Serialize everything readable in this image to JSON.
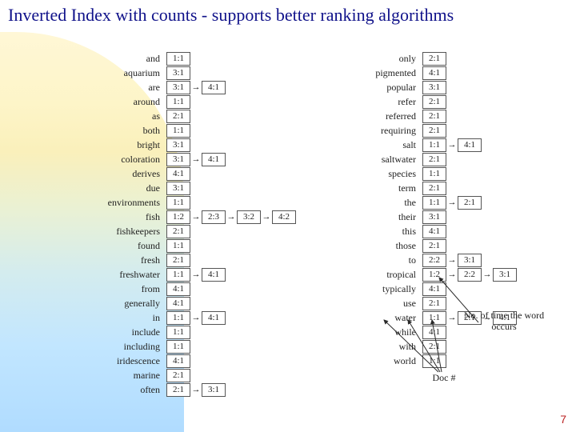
{
  "title": "Inverted Index with counts - supports better ranking algorithms",
  "page_number": "7",
  "notes": {
    "count_label": "No. of time the word occurs",
    "docnum_label": "Doc #"
  },
  "left_column": [
    {
      "term": "and",
      "postings": [
        "1:1"
      ]
    },
    {
      "term": "aquarium",
      "postings": [
        "3:1"
      ]
    },
    {
      "term": "are",
      "postings": [
        "3:1",
        "4:1"
      ]
    },
    {
      "term": "around",
      "postings": [
        "1:1"
      ]
    },
    {
      "term": "as",
      "postings": [
        "2:1"
      ]
    },
    {
      "term": "both",
      "postings": [
        "1:1"
      ]
    },
    {
      "term": "bright",
      "postings": [
        "3:1"
      ]
    },
    {
      "term": "coloration",
      "postings": [
        "3:1",
        "4:1"
      ]
    },
    {
      "term": "derives",
      "postings": [
        "4:1"
      ]
    },
    {
      "term": "due",
      "postings": [
        "3:1"
      ]
    },
    {
      "term": "environments",
      "postings": [
        "1:1"
      ]
    },
    {
      "term": "fish",
      "postings": [
        "1:2",
        "2:3",
        "3:2",
        "4:2"
      ]
    },
    {
      "term": "fishkeepers",
      "postings": [
        "2:1"
      ]
    },
    {
      "term": "found",
      "postings": [
        "1:1"
      ]
    },
    {
      "term": "fresh",
      "postings": [
        "2:1"
      ]
    },
    {
      "term": "freshwater",
      "postings": [
        "1:1",
        "4:1"
      ]
    },
    {
      "term": "from",
      "postings": [
        "4:1"
      ]
    },
    {
      "term": "generally",
      "postings": [
        "4:1"
      ]
    },
    {
      "term": "in",
      "postings": [
        "1:1",
        "4:1"
      ]
    },
    {
      "term": "include",
      "postings": [
        "1:1"
      ]
    },
    {
      "term": "including",
      "postings": [
        "1:1"
      ]
    },
    {
      "term": "iridescence",
      "postings": [
        "4:1"
      ]
    },
    {
      "term": "marine",
      "postings": [
        "2:1"
      ]
    },
    {
      "term": "often",
      "postings": [
        "2:1",
        "3:1"
      ]
    }
  ],
  "right_column": [
    {
      "term": "only",
      "postings": [
        "2:1"
      ]
    },
    {
      "term": "pigmented",
      "postings": [
        "4:1"
      ]
    },
    {
      "term": "popular",
      "postings": [
        "3:1"
      ]
    },
    {
      "term": "refer",
      "postings": [
        "2:1"
      ]
    },
    {
      "term": "referred",
      "postings": [
        "2:1"
      ]
    },
    {
      "term": "requiring",
      "postings": [
        "2:1"
      ]
    },
    {
      "term": "salt",
      "postings": [
        "1:1",
        "4:1"
      ]
    },
    {
      "term": "saltwater",
      "postings": [
        "2:1"
      ]
    },
    {
      "term": "species",
      "postings": [
        "1:1"
      ]
    },
    {
      "term": "term",
      "postings": [
        "2:1"
      ]
    },
    {
      "term": "the",
      "postings": [
        "1:1",
        "2:1"
      ]
    },
    {
      "term": "their",
      "postings": [
        "3:1"
      ]
    },
    {
      "term": "this",
      "postings": [
        "4:1"
      ]
    },
    {
      "term": "those",
      "postings": [
        "2:1"
      ]
    },
    {
      "term": "to",
      "postings": [
        "2:2",
        "3:1"
      ]
    },
    {
      "term": "tropical",
      "postings": [
        "1:2",
        "2:2",
        "3:1"
      ]
    },
    {
      "term": "typically",
      "postings": [
        "4:1"
      ]
    },
    {
      "term": "use",
      "postings": [
        "2:1"
      ]
    },
    {
      "term": "water",
      "postings": [
        "1:1",
        "2:1",
        "4:1"
      ]
    },
    {
      "term": "while",
      "postings": [
        "4:1"
      ]
    },
    {
      "term": "with",
      "postings": [
        "2:1"
      ]
    },
    {
      "term": "world",
      "postings": [
        "1:1"
      ]
    }
  ]
}
